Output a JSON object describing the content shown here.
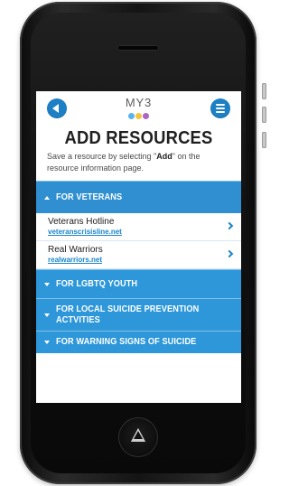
{
  "app": {
    "logo_text": "MY3",
    "title": "ADD RESOURCES",
    "instructions_prefix": "Save a resource by selecting \"",
    "instructions_bold": "Add",
    "instructions_suffix": "\" on the resource information page."
  },
  "icons": {
    "back": "back-icon",
    "menu": "menu-icon",
    "chevron": "chevron-right-icon",
    "home": "home-icon"
  },
  "colors": {
    "accent": "#1d7fc4",
    "section": "#2d97d9",
    "logo_dot_1": "#58b3ea",
    "logo_dot_2": "#f3c53d",
    "logo_dot_3": "#ac65c8"
  },
  "sections": [
    {
      "label": "FOR VETERANS",
      "expanded": true,
      "items": [
        {
          "name": "Veterans Hotline",
          "link": "veteranscrisisline.net"
        },
        {
          "name": "Real Warriors",
          "link": "realwarriors.net"
        }
      ]
    },
    {
      "label": "FOR LGBTQ YOUTH",
      "expanded": false
    },
    {
      "label": "FOR LOCAL SUICIDE PREVENTION ACTVITIES",
      "expanded": false
    },
    {
      "label": "FOR WARNING SIGNS OF SUICIDE",
      "expanded": false
    }
  ]
}
